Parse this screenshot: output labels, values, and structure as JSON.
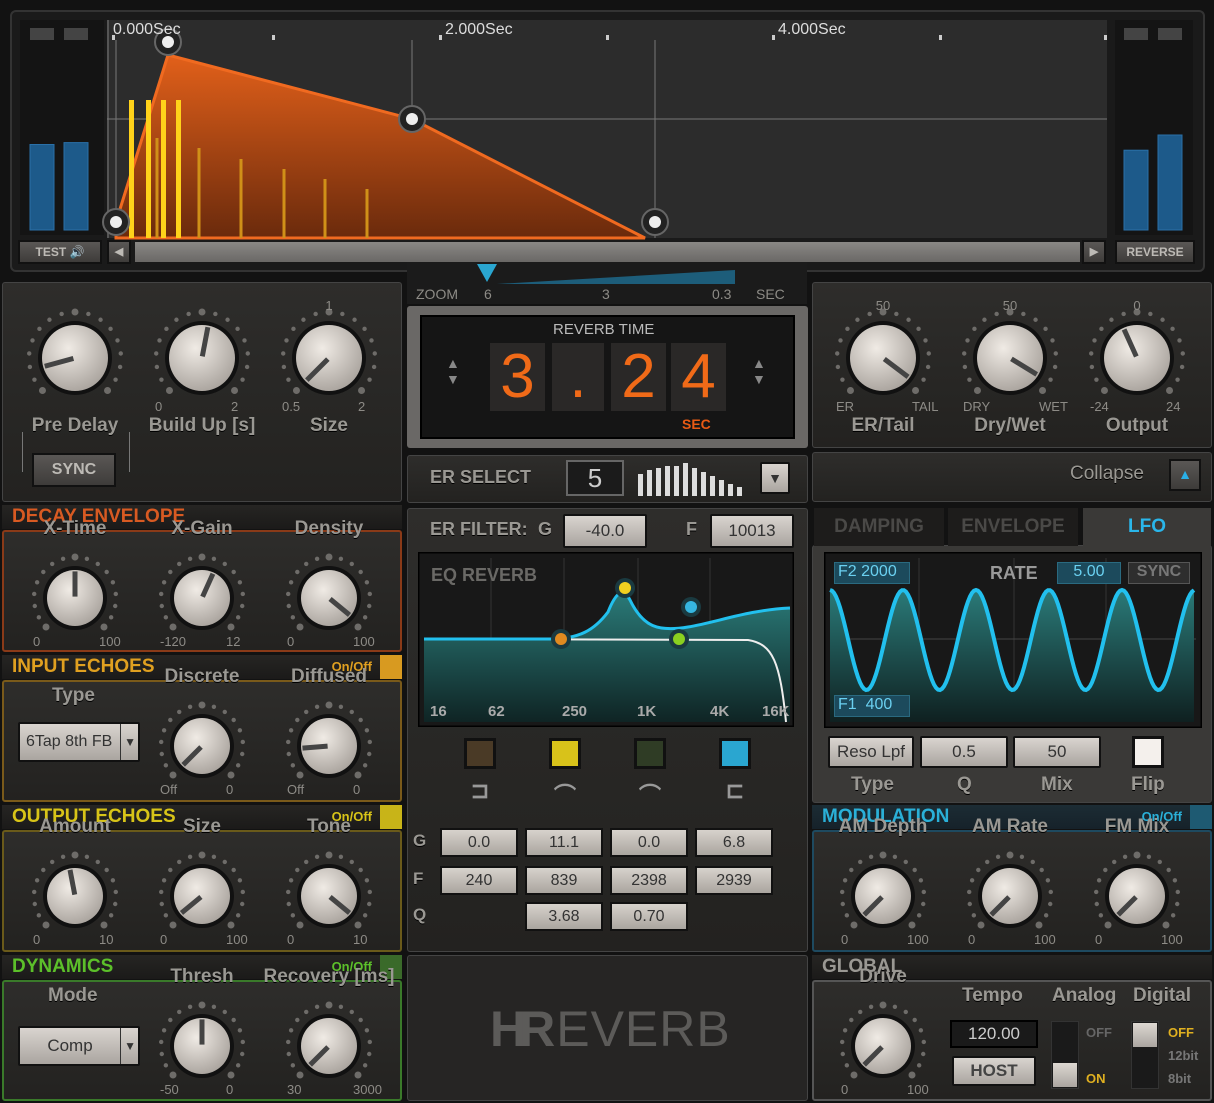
{
  "envelope": {
    "time_labels": [
      "0.000Sec",
      "2.000Sec",
      "4.000Sec"
    ],
    "test_label": "TEST",
    "reverse_label": "REVERSE",
    "meters_left": [
      0.45,
      0.46
    ],
    "meters_right": [
      0.42,
      0.5
    ]
  },
  "zoom": {
    "label": "ZOOM",
    "ticks": [
      "6",
      "3",
      "0.3"
    ],
    "unit": "SEC"
  },
  "reverb_time": {
    "title": "REVERB TIME",
    "digits": [
      "3",
      ".",
      "2",
      "4"
    ],
    "unit": "SEC"
  },
  "er_select": {
    "label": "ER SELECT",
    "value": "5"
  },
  "collapse": {
    "label": "Collapse"
  },
  "top_left": {
    "knobs": [
      {
        "label": "Pre Delay",
        "min": "",
        "max": "",
        "top": "",
        "value": 0.11
      },
      {
        "label": "Build Up [s]",
        "min": "0",
        "max": "2",
        "top": "",
        "value": 0.54
      },
      {
        "label": "Size",
        "min": "0.5",
        "max": "2",
        "top": "1",
        "value": 0.0
      }
    ],
    "sync_label": "SYNC"
  },
  "top_right": {
    "knobs": [
      {
        "label": "ER/Tail",
        "min": "ER",
        "max": "TAIL",
        "top": "50",
        "value": 0.97
      },
      {
        "label": "Dry/Wet",
        "min": "DRY",
        "max": "WET",
        "top": "50",
        "value": 0.95
      },
      {
        "label": "Output",
        "min": "-24",
        "max": "24",
        "top": "0",
        "value": 0.41
      }
    ]
  },
  "decay": {
    "title": "DECAY ENVELOPE",
    "knobs": [
      {
        "label": "X-Time",
        "min": "0",
        "max": "100",
        "value": 0.5
      },
      {
        "label": "X-Gain",
        "min": "-120",
        "max": "12",
        "value": 0.59
      },
      {
        "label": "Density",
        "min": "0",
        "max": "100",
        "value": 0.98
      }
    ]
  },
  "input_echoes": {
    "title": "INPUT ECHOES",
    "onoff": "On/Off",
    "type_label": "Type",
    "type_value": "6Tap 8th FB",
    "knobs": [
      {
        "label": "Discrete",
        "min": "Off",
        "max": "0",
        "value": 0.0
      },
      {
        "label": "Diffused",
        "min": "Off",
        "max": "0",
        "value": 0.15
      }
    ]
  },
  "output_echoes": {
    "title": "OUTPUT ECHOES",
    "onoff": "On/Off",
    "knobs": [
      {
        "label": "Amount",
        "min": "0",
        "max": "10",
        "value": 0.46
      },
      {
        "label": "Size",
        "min": "0",
        "max": "100",
        "value": 0.02
      },
      {
        "label": "Tone",
        "min": "0",
        "max": "10",
        "value": 0.98
      }
    ]
  },
  "dynamics": {
    "title": "DYNAMICS",
    "onoff": "On/Off",
    "mode_label": "Mode",
    "mode_value": "Comp",
    "knobs": [
      {
        "label": "Thresh",
        "min": "-50",
        "max": "0",
        "value": 0.5
      },
      {
        "label": "Recovery [ms]",
        "min": "30",
        "max": "3000",
        "value": 0.0
      }
    ]
  },
  "er_filter": {
    "label": "ER FILTER:",
    "g_label": "G",
    "g_value": "-40.0",
    "f_label": "F",
    "f_value": "10013"
  },
  "eq": {
    "title": "EQ REVERB",
    "freq_labels": [
      "16",
      "62",
      "250",
      "1K",
      "4K",
      "16K"
    ],
    "band_colors": [
      "#4a3a26",
      "#d8c21a",
      "#2f3c25",
      "#2aa6d0"
    ],
    "band_icons": [
      "low-shelf-icon",
      "bell-icon",
      "bell-icon",
      "high-shelf-icon"
    ],
    "rows": {
      "G": [
        "0.0",
        "11.1",
        "0.0",
        "6.8"
      ],
      "F": [
        "240",
        "839",
        "2398",
        "2939"
      ],
      "Q": [
        "",
        "3.68",
        "0.70",
        ""
      ]
    },
    "row_labels": [
      "G",
      "F",
      "Q"
    ]
  },
  "logo": {
    "text_h": "H",
    "text_r": "R",
    "text_rest": "EVERB"
  },
  "tabs": [
    {
      "label": "DAMPING",
      "active": false
    },
    {
      "label": "ENVELOPE",
      "active": false
    },
    {
      "label": "LFO",
      "active": true
    }
  ],
  "lfo": {
    "f2": "F2 2000",
    "f1": "F1  400",
    "rate_label": "RATE",
    "rate_value": "5.00",
    "sync_label": "SYNC",
    "type_value": "Reso Lpf",
    "q_value": "0.5",
    "mix_value": "50",
    "labels": [
      "Type",
      "Q",
      "Mix",
      "Flip"
    ]
  },
  "modulation": {
    "title": "MODULATION",
    "onoff": "On/Off",
    "knobs": [
      {
        "label": "AM Depth",
        "min": "0",
        "max": "100",
        "value": 0.0
      },
      {
        "label": "AM Rate",
        "min": "0",
        "max": "100",
        "value": 0.0
      },
      {
        "label": "FM Mix",
        "min": "0",
        "max": "100",
        "value": 0.0
      }
    ]
  },
  "global": {
    "title": "GLOBAL",
    "drive": {
      "label": "Drive",
      "min": "0",
      "max": "100",
      "value": 0.0
    },
    "tempo_label": "Tempo",
    "tempo_value": "120.00",
    "host_label": "HOST",
    "analog_label": "Analog",
    "analog_off": "OFF",
    "analog_on": "ON",
    "digital_label": "Digital",
    "digital_options": [
      "OFF",
      "12bit",
      "8bit"
    ]
  },
  "colors": {
    "orange": "#e2601a",
    "accent_blue": "#27b6e6",
    "decay": "#d2541c",
    "input": "#e0a020",
    "output": "#d8c418",
    "dynamics": "#5cc02a",
    "modulation": "#2aa0c8"
  }
}
